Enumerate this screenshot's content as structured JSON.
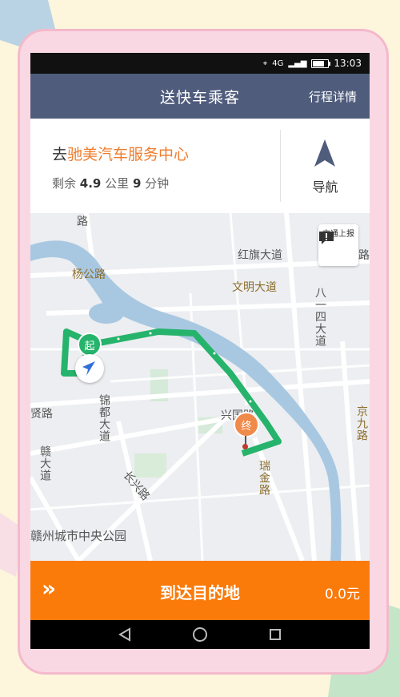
{
  "status_bar": {
    "time": "13:03",
    "network": "4G"
  },
  "header": {
    "title": "送快车乘客",
    "detail_label": "行程详情"
  },
  "destination": {
    "prefix": "去",
    "place": "驰美汽车服务中心",
    "remain_prefix": "剩余",
    "distance": "4.9",
    "distance_unit": "公里",
    "minutes": "9",
    "minutes_unit": "分钟"
  },
  "navigation": {
    "label": "导航",
    "icon": "navigation-arrow-icon"
  },
  "map": {
    "traffic_report_label": "交通上报",
    "start_marker": "起",
    "end_marker": "终",
    "labels": {
      "hongqi": "红旗大道",
      "yanggong": "杨公路",
      "wenming": "文明大道",
      "bayisi": "八一四大道",
      "jiujiu": "京九路",
      "gandu": "锦都大道",
      "changxing": "长兴路",
      "ruijin": "瑞金路",
      "xing": "兴国路",
      "xian": "贤路",
      "lu_top": "路",
      "lu_right": "路",
      "deng": "赣大道",
      "park": "赣州城市中央公园"
    }
  },
  "arrive": {
    "label": "到达目的地",
    "fare": "0.0元"
  },
  "colors": {
    "header": "#4f5c7c",
    "accent": "#fa7a0a",
    "place": "#f07c2d",
    "route": "#26b36b"
  }
}
